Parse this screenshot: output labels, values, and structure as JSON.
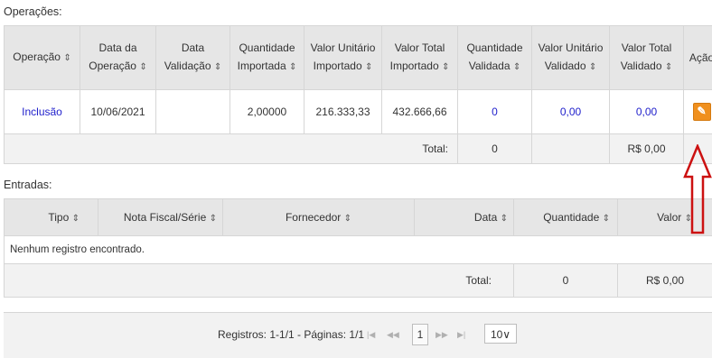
{
  "operations": {
    "title": "Operações:",
    "headers": [
      {
        "l1": "Operação",
        "l2": ""
      },
      {
        "l1": "Data da",
        "l2": "Operação"
      },
      {
        "l1": "Data",
        "l2": "Validação"
      },
      {
        "l1": "Quantidade",
        "l2": "Importada"
      },
      {
        "l1": "Valor Unitário",
        "l2": "Importado"
      },
      {
        "l1": "Valor Total",
        "l2": "Importado"
      },
      {
        "l1": "Quantidade",
        "l2": "Validada"
      },
      {
        "l1": "Valor Unitário",
        "l2": "Validado"
      },
      {
        "l1": "Valor Total",
        "l2": "Validado"
      },
      {
        "l1": "Ação",
        "l2": ""
      }
    ],
    "sort_icon": "⇕",
    "row": {
      "operacao": "Inclusão",
      "data_operacao": "10/06/2021",
      "data_validacao": "",
      "qtd_importada": "2,00000",
      "vu_importado": "216.333,33",
      "vt_importado": "432.666,66",
      "qtd_validada": "0",
      "vu_validado": "0,00",
      "vt_validado": "0,00"
    },
    "total": {
      "label": "Total:",
      "qtd": "0",
      "valor": "R$ 0,00"
    }
  },
  "entries": {
    "title": "Entradas:",
    "headers": [
      "Tipo",
      "Nota Fiscal/Série",
      "Fornecedor",
      "Data",
      "Quantidade",
      "Valor"
    ],
    "empty": "Nenhum registro encontrado.",
    "total": {
      "label": "Total:",
      "qtd": "0",
      "valor": "R$ 0,00"
    }
  },
  "pager": {
    "summary": "Registros: 1-1/1 - Páginas: 1/1",
    "first": "|◀",
    "prev": "◀◀",
    "current": "1",
    "next": "▶▶",
    "last": "▶|",
    "page_size": "10",
    "caret": "∨"
  },
  "colors": {
    "accent": "#f0901e",
    "link": "#2222cc",
    "annotation": "#cc1111"
  },
  "icons": {
    "action": "edit-icon",
    "annotation": "red-up-arrow"
  }
}
